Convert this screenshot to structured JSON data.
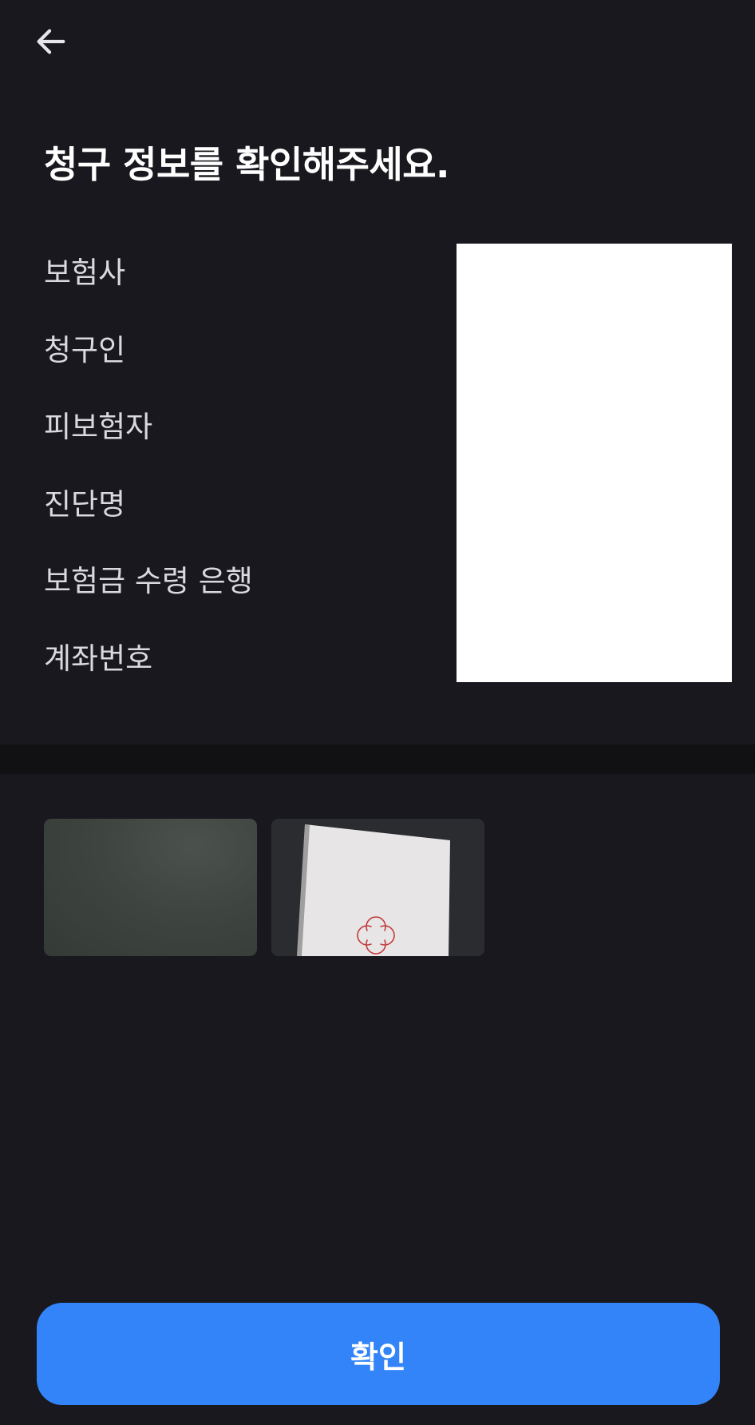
{
  "header": {
    "back_icon": "arrow-left-icon"
  },
  "title": "청구 정보를 확인해주세요.",
  "claim_info": {
    "labels": [
      "보험사",
      "청구인",
      "피보험자",
      "진단명",
      "보험금 수령 은행",
      "계좌번호"
    ]
  },
  "attachments": {
    "thumbnails": [
      {
        "name": "attachment-photo-1"
      },
      {
        "name": "attachment-photo-2"
      }
    ]
  },
  "footer": {
    "confirm_label": "확인"
  },
  "colors": {
    "background": "#19181e",
    "divider": "#111114",
    "primary": "#3384f8",
    "label_text": "#d9d9de"
  }
}
